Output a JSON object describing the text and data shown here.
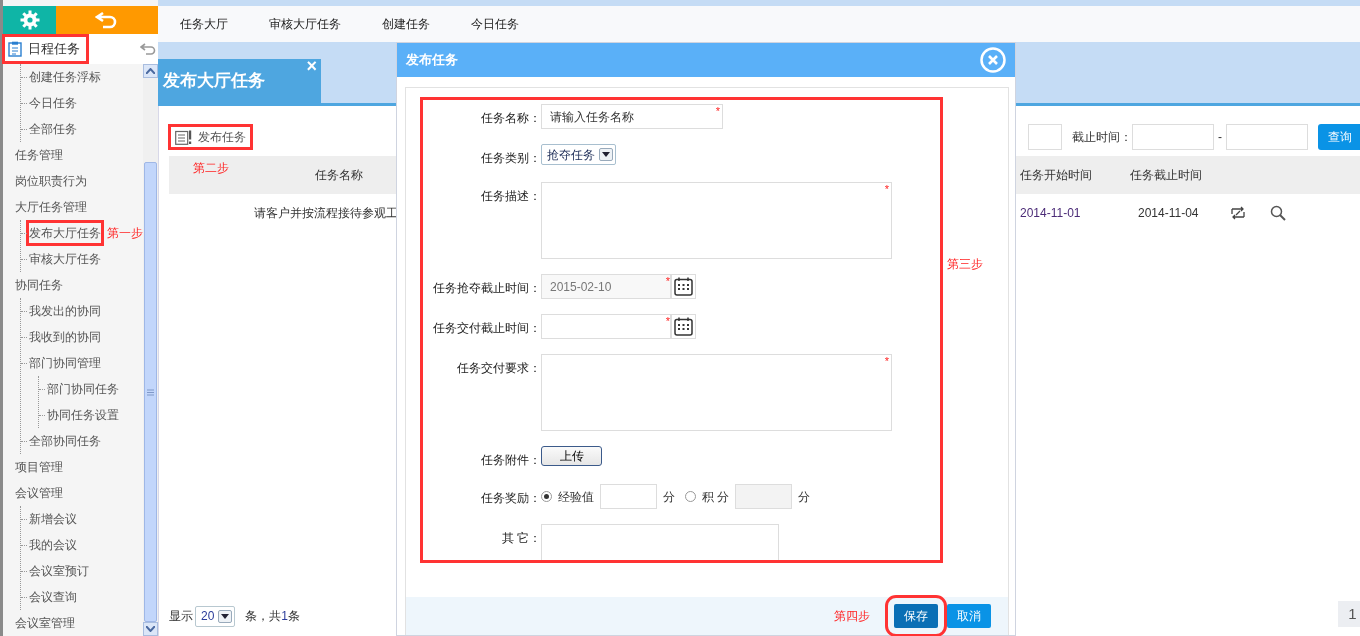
{
  "sidebar": {
    "tree": [
      {
        "label": "日程任务",
        "kind": "header",
        "highlighted": true,
        "children": [
          {
            "label": "创建任务浮标",
            "highlighted": false
          },
          {
            "label": "今日任务",
            "highlighted": false
          },
          {
            "label": "全部任务",
            "highlighted": false
          }
        ]
      },
      {
        "label": "任务管理",
        "kind": "item",
        "highlighted": false
      },
      {
        "label": "岗位职责行为",
        "kind": "item",
        "highlighted": false
      },
      {
        "label": "大厅任务管理",
        "kind": "item",
        "highlighted": false,
        "children": [
          {
            "label": "发布大厅任务",
            "highlighted": true,
            "step_note": "第一步"
          },
          {
            "label": "审核大厅任务",
            "highlighted": false
          }
        ]
      },
      {
        "label": "协同任务",
        "kind": "item",
        "highlighted": false,
        "children": [
          {
            "label": "我发出的协同",
            "highlighted": false
          },
          {
            "label": "我收到的协同",
            "highlighted": false
          },
          {
            "label": "部门协同管理",
            "highlighted": false,
            "children": [
              {
                "label": "部门协同任务",
                "highlighted": false
              },
              {
                "label": "协同任务设置",
                "highlighted": false
              }
            ]
          },
          {
            "label": "全部协同任务",
            "highlighted": false
          }
        ]
      },
      {
        "label": "项目管理",
        "kind": "item",
        "highlighted": false
      },
      {
        "label": "会议管理",
        "kind": "item",
        "highlighted": false,
        "children": [
          {
            "label": "新增会议",
            "highlighted": false
          },
          {
            "label": "我的会议",
            "highlighted": false
          },
          {
            "label": "会议室预订",
            "highlighted": false
          },
          {
            "label": "会议查询",
            "highlighted": false
          }
        ]
      },
      {
        "label": "会议室管理",
        "kind": "item",
        "highlighted": false
      }
    ]
  },
  "top_nav": [
    "任务大厅",
    "审核大厅任务",
    "创建任务",
    "今日任务"
  ],
  "page_tab": {
    "title": "发布大厅任务",
    "close": "×"
  },
  "toolbar": {
    "button": "发布任务",
    "highlighted": true,
    "step_note": "第二步"
  },
  "search": {
    "label": "截止时间：",
    "separator": "-",
    "button": "查询"
  },
  "table": {
    "columns": [
      "任务名称",
      "任务开始时间",
      "任务截止时间"
    ],
    "rows": [
      {
        "name": "请客户并按流程接待参观工",
        "start": "2014-11-01",
        "end": "2014-11-04"
      }
    ]
  },
  "pagination": {
    "prefix": "显示",
    "page_size": "20",
    "middle": "条，共",
    "total": "1",
    "suffix": "条",
    "page": "1"
  },
  "dialog": {
    "title": "发布任务",
    "step_note": "第三步",
    "fields": [
      {
        "kind": "text",
        "label": "任务名称：",
        "placeholder": "请输入任务名称",
        "required_mark": "*"
      },
      {
        "kind": "select",
        "label": "任务类别：",
        "value": "抢夺任务"
      },
      {
        "kind": "textarea",
        "label": "任务描述：",
        "required_mark": "*"
      },
      {
        "kind": "date",
        "label": "任务抢夺截止时间：",
        "value": "2015-02-10",
        "required_mark": "*"
      },
      {
        "kind": "date",
        "label": "任务交付截止时间：",
        "required_mark": "*"
      },
      {
        "kind": "textarea",
        "label": "任务交付要求：",
        "required_mark": "*"
      },
      {
        "kind": "upload",
        "label": "任务附件：",
        "button": "上传"
      },
      {
        "kind": "reward",
        "label": "任务奖励：",
        "options": [
          {
            "label": "经验值",
            "selected": true,
            "unit": "分"
          },
          {
            "label": "积 分",
            "selected": false,
            "unit": "分"
          }
        ]
      },
      {
        "kind": "note",
        "label": "其 它："
      }
    ],
    "footer": {
      "step_note": "第四步",
      "buttons": [
        {
          "label": "保存",
          "kind": "primary",
          "highlighted": true
        },
        {
          "label": "取消",
          "kind": "secondary",
          "highlighted": false
        }
      ]
    }
  }
}
